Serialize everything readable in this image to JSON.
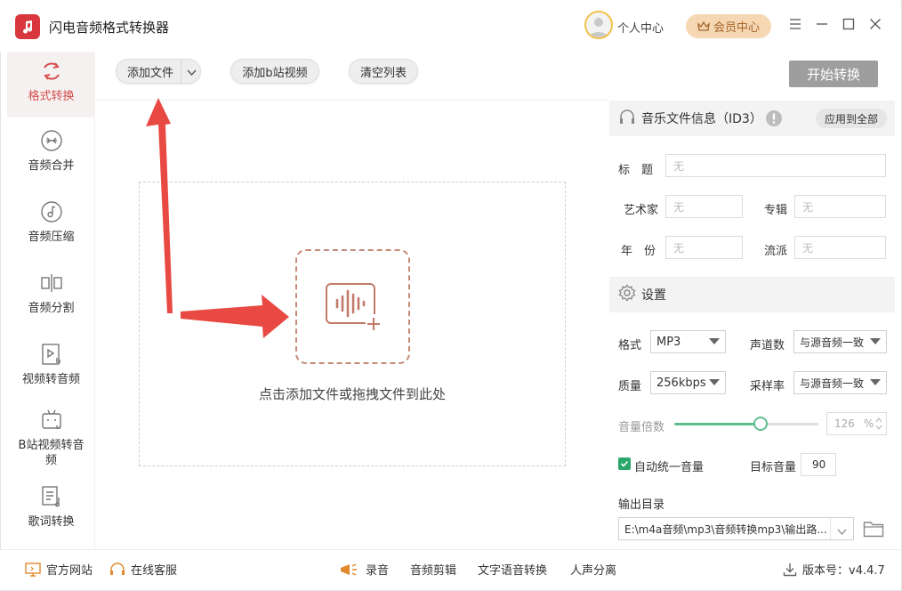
{
  "app": {
    "title": "闪电音频格式转换器"
  },
  "header": {
    "user_center": "个人中心",
    "vip_label": "会员中心"
  },
  "sidebar": {
    "items": [
      {
        "label": "格式转换",
        "icon": "convert-icon",
        "active": true
      },
      {
        "label": "音频合并",
        "icon": "merge-icon"
      },
      {
        "label": "音频压缩",
        "icon": "compress-icon"
      },
      {
        "label": "音频分割",
        "icon": "split-icon"
      },
      {
        "label": "视频转音频",
        "icon": "video-to-audio-icon"
      },
      {
        "label": "B站视频转音频",
        "icon": "bilibili-icon"
      },
      {
        "label": "歌词转换",
        "icon": "lyrics-icon"
      }
    ]
  },
  "toolbar": {
    "add_file": "添加文件",
    "add_bilibili": "添加b站视频",
    "clear_list": "清空列表",
    "start": "开始转换"
  },
  "dropzone": {
    "hint": "点击添加文件或拖拽文件到此处"
  },
  "id3": {
    "header": "音乐文件信息（ID3）",
    "apply_all": "应用到全部",
    "title_label": "标　题",
    "artist_label": "艺术家",
    "album_label": "专辑",
    "year_label": "年　份",
    "genre_label": "流派",
    "placeholder": "无"
  },
  "settings": {
    "header": "设置",
    "format_label": "格式",
    "format_value": "MP3",
    "channels_label": "声道数",
    "channels_value": "与源音频一致",
    "quality_label": "质量",
    "quality_value": "256kbps",
    "samplerate_label": "采样率",
    "samplerate_value": "与源音频一致",
    "volume_label": "音量倍数",
    "volume_value": "126",
    "volume_unit": "%",
    "volume_fraction": 0.6,
    "auto_volume_label": "自动统一音量",
    "target_volume_label": "目标音量",
    "target_volume_value": "90",
    "output_dir_label": "输出目录",
    "output_dir_value": "E:\\m4a音频\\mp3\\音频转换mp3\\输出路..."
  },
  "bottom": {
    "website": "官方网站",
    "service": "在线客服",
    "record": "录音",
    "edit": "音频剪辑",
    "tts": "文字语音转换",
    "vocal": "人声分离",
    "version": "版本号：v4.4.7"
  },
  "colors": {
    "accent_red": "#d8383d",
    "green": "#2aa66a",
    "arrow": "#e84a43"
  }
}
